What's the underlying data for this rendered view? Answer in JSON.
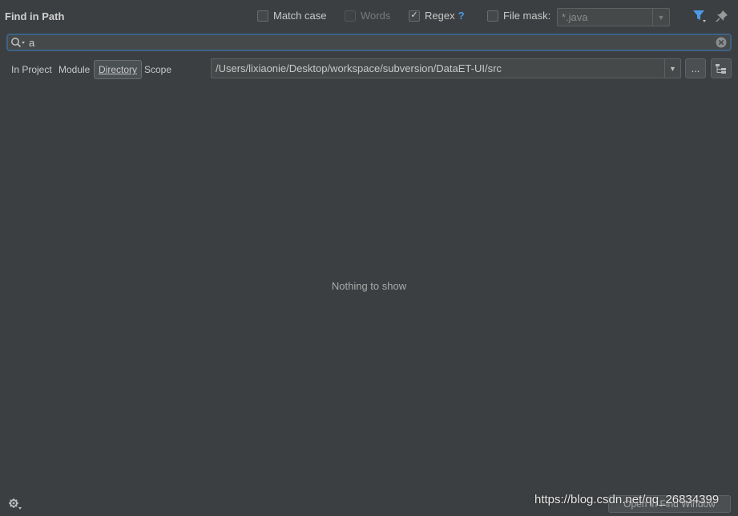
{
  "header": {
    "title": "Find in Path",
    "match_case_label": "Match case",
    "words_label": "Words",
    "regex_label": "Regex",
    "regex_help": "?",
    "file_mask_label": "File mask:",
    "file_mask_value": "*.java"
  },
  "search": {
    "value": "a"
  },
  "scope": {
    "in_project": "In Project",
    "module": "Module",
    "directory": "Directory",
    "scope": "Scope",
    "directory_path": "/Users/lixiaonie/Desktop/workspace/subversion/DataET-UI/src",
    "browse_label": "..."
  },
  "results": {
    "empty_text": "Nothing to show"
  },
  "footer": {
    "open_in_find_window": "Open in Find Window"
  },
  "watermark": "https://blog.csdn.net/qq_26834399",
  "colors": {
    "background": "#3c3f41",
    "accent": "#4c9be8",
    "search_border": "#3d6185"
  }
}
